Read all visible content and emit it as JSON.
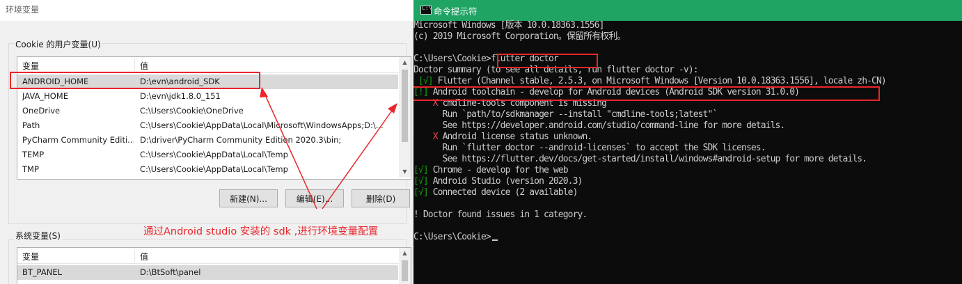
{
  "env_dialog": {
    "title": "环境变量",
    "user_vars": {
      "group_label": "Cookie 的用户变量(U)",
      "col_name": "变量",
      "col_value": "值",
      "rows": [
        {
          "name": "ANDROID_HOME",
          "value": "D:\\evn\\android_SDK"
        },
        {
          "name": "JAVA_HOME",
          "value": "D:\\evn\\jdk1.8.0_151"
        },
        {
          "name": "OneDrive",
          "value": "C:\\Users\\Cookie\\OneDrive"
        },
        {
          "name": "Path",
          "value": "C:\\Users\\Cookie\\AppData\\Local\\Microsoft\\WindowsApps;D:\\..."
        },
        {
          "name": "PyCharm Community Editi...",
          "value": "D:\\driver\\PyCharm Community Edition 2020.3\\bin;"
        },
        {
          "name": "TEMP",
          "value": "C:\\Users\\Cookie\\AppData\\Local\\Temp"
        },
        {
          "name": "TMP",
          "value": "C:\\Users\\Cookie\\AppData\\Local\\Temp"
        }
      ],
      "buttons": {
        "new": "新建(N)...",
        "edit": "编辑(E)...",
        "delete": "删除(D)"
      }
    },
    "system_vars": {
      "group_label": "系统变量(S)",
      "col_name": "变量",
      "col_value": "值",
      "rows": [
        {
          "name": "BT_PANEL",
          "value": "D:\\BtSoft\\panel"
        }
      ]
    },
    "annotation": "通过Android studio 安装的 sdk ,进行环境变量配置",
    "highlight_color": "#e8262b"
  },
  "cmd": {
    "title": "命令提示符",
    "lines": {
      "l1": "Microsoft Windows [版本 10.0.18363.1556]",
      "l2": "(c) 2019 Microsoft Corporation。保留所有权利。",
      "l3": "",
      "l4_prompt": "C:\\Users\\Cookie>",
      "l4_cmd": "flutter doctor",
      "l5": "Doctor summary (to see all details, run flutter doctor -v):",
      "l6_mark": "[√]",
      "l6_text": " Flutter (Channel stable, 2.5.3, on Microsoft Windows [Version 10.0.18363.1556], locale zh-CN)",
      "l7_mark": "[!]",
      "l7_text": " Android toolchain - develop for Android devices (Android SDK version 31.0.0)",
      "l8_x": "X",
      "l8_text": " cmdline-tools component is missing",
      "l9": "      Run `path/to/sdkmanager --install \"cmdline-tools;latest\"`",
      "l10": "      See https://developer.android.com/studio/command-line for more details.",
      "l11_x": "X",
      "l11_text": " Android license status unknown.",
      "l12": "      Run `flutter doctor --android-licenses` to accept the SDK licenses.",
      "l13": "      See https://flutter.dev/docs/get-started/install/windows#android-setup for more details.",
      "l14_mark": "[√]",
      "l14_text": " Chrome - develop for the web",
      "l15_mark": "[√]",
      "l15_text": " Android Studio (version 2020.3)",
      "l16_mark": "[√]",
      "l16_text": " Connected device (2 available)",
      "l17": "",
      "l18": "! Doctor found issues in 1 category.",
      "l19": "",
      "l20_prompt": "C:\\Users\\Cookie>"
    },
    "colors": {
      "background": "#0c0c0c",
      "text": "#cccccc",
      "ok": "#13a10e",
      "error": "#e74856",
      "titlebar": "#1fa463"
    }
  }
}
